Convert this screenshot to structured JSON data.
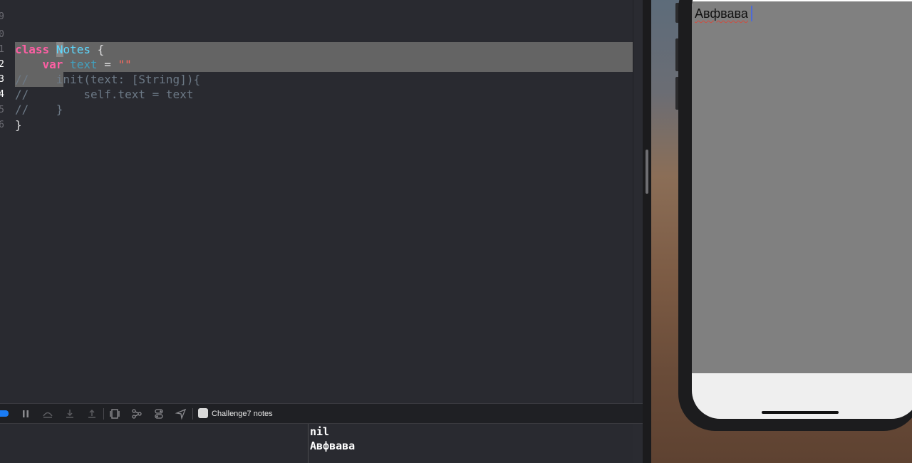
{
  "editor": {
    "lines": [
      {
        "num": "9"
      },
      {
        "num": "0"
      },
      {
        "num": "1"
      },
      {
        "num": "2"
      },
      {
        "num": "3"
      },
      {
        "num": "4"
      },
      {
        "num": "5"
      },
      {
        "num": "6"
      }
    ],
    "code": {
      "kw_class": "class",
      "type_notes": "Notes",
      "brace_open": " {",
      "indent": "    ",
      "kw_var": "var",
      "prop_text": "text",
      "assign": " = ",
      "str_empty": "\"\"",
      "line12_comment": "//    ",
      "line12_init": "init(text: [String]){",
      "line13": "//        self.text = text",
      "line14_comment": "//    ",
      "line14_brace": "}",
      "brace_close": "}"
    }
  },
  "debug_bar": {
    "target_label": "Challenge7 notes",
    "icons": [
      "breakpoints-toggle-icon",
      "pause-icon",
      "step-over-icon",
      "step-into-icon",
      "step-out-icon",
      "view-debugger-icon",
      "memory-graph-icon",
      "environment-overrides-icon",
      "location-icon",
      "app-icon"
    ]
  },
  "console": {
    "lines": [
      "nil",
      "Авфвава"
    ]
  },
  "simulator": {
    "textview_text": "Авфвава"
  },
  "colors": {
    "editor_bg": "#292a30",
    "keyword": "#fc5fa3",
    "type": "#5dd8ff",
    "string": "#fc6a5d",
    "comment": "#6c7986",
    "selection": "#646464",
    "accent_blue": "#1a7cf5",
    "textview_bg": "#808080"
  }
}
